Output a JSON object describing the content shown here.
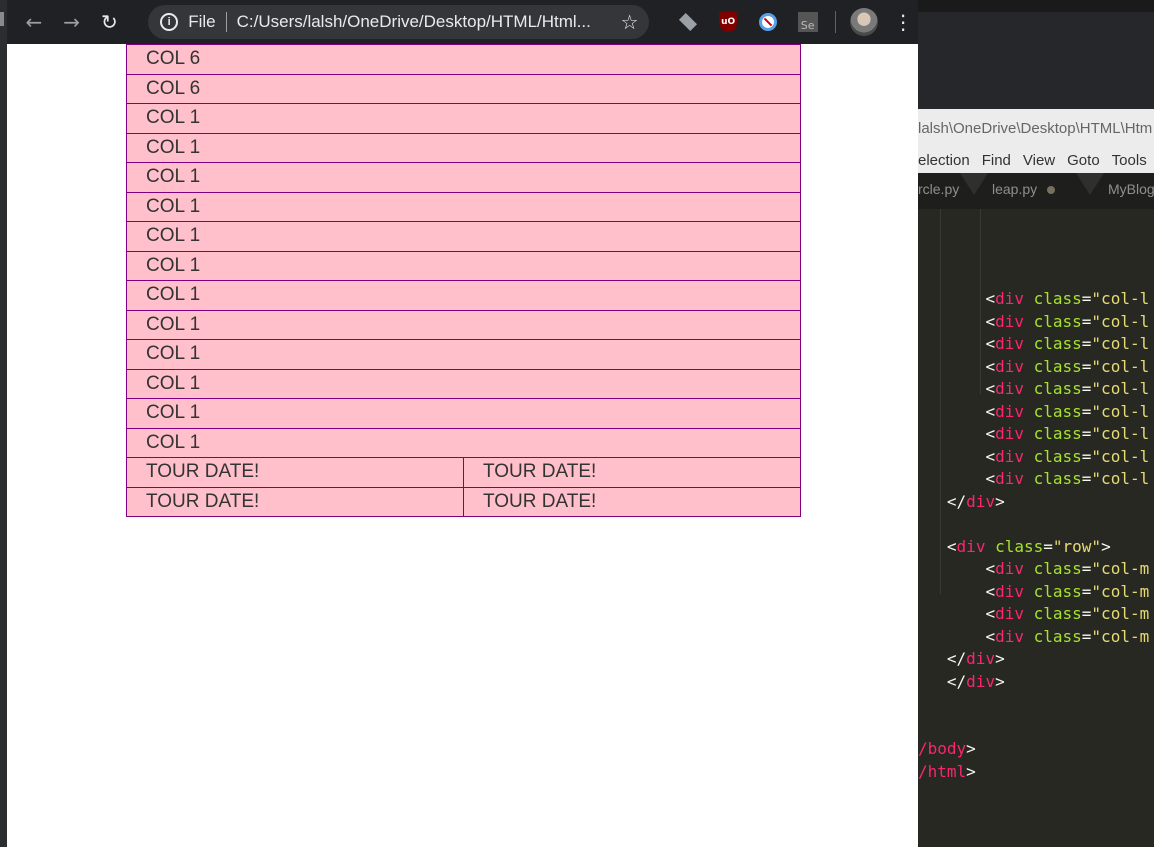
{
  "browser": {
    "omnibox": {
      "scheme": "File",
      "url": "C:/Users/lalsh/OneDrive/Desktop/HTML/Html..."
    },
    "extensions": [
      "layers-icon",
      "ublock-icon",
      "no-entry-icon",
      "selenium-icon"
    ]
  },
  "page": {
    "rows": [
      [
        "COL 6"
      ],
      [
        "COL 6"
      ],
      [
        "COL 1"
      ],
      [
        "COL 1"
      ],
      [
        "COL 1"
      ],
      [
        "COL 1"
      ],
      [
        "COL 1"
      ],
      [
        "COL 1"
      ],
      [
        "COL 1"
      ],
      [
        "COL 1"
      ],
      [
        "COL 1"
      ],
      [
        "COL 1"
      ],
      [
        "COL 1"
      ],
      [
        "COL 1"
      ],
      [
        "TOUR DATE!",
        "TOUR DATE!"
      ],
      [
        "TOUR DATE!",
        "TOUR DATE!"
      ]
    ],
    "colors": {
      "cell_bg": "#ffc0cb",
      "cell_border": "#800080"
    }
  },
  "editor": {
    "title": "lalsh\\OneDrive\\Desktop\\HTML\\Htm",
    "menu": [
      "election",
      "Find",
      "View",
      "Goto",
      "Tools"
    ],
    "tabs": [
      "rcle.py",
      "leap.py",
      "MyBlog"
    ],
    "code_lines": [
      {
        "indent": "       ",
        "open": "<",
        "tag": "div",
        "attr": " class",
        "eq": "=",
        "str": "\"col-l",
        "close": "",
        "partial_top": true
      },
      {
        "indent": "       ",
        "open": "<",
        "tag": "div",
        "attr": " class",
        "eq": "=",
        "str": "\"col-l",
        "close": ""
      },
      {
        "indent": "       ",
        "open": "<",
        "tag": "div",
        "attr": " class",
        "eq": "=",
        "str": "\"col-l",
        "close": ""
      },
      {
        "indent": "       ",
        "open": "<",
        "tag": "div",
        "attr": " class",
        "eq": "=",
        "str": "\"col-l",
        "close": ""
      },
      {
        "indent": "       ",
        "open": "<",
        "tag": "div",
        "attr": " class",
        "eq": "=",
        "str": "\"col-l",
        "close": ""
      },
      {
        "indent": "       ",
        "open": "<",
        "tag": "div",
        "attr": " class",
        "eq": "=",
        "str": "\"col-l",
        "close": ""
      },
      {
        "indent": "       ",
        "open": "<",
        "tag": "div",
        "attr": " class",
        "eq": "=",
        "str": "\"col-l",
        "close": ""
      },
      {
        "indent": "       ",
        "open": "<",
        "tag": "div",
        "attr": " class",
        "eq": "=",
        "str": "\"col-l",
        "close": ""
      },
      {
        "indent": "       ",
        "open": "<",
        "tag": "div",
        "attr": " class",
        "eq": "=",
        "str": "\"col-l",
        "close": ""
      },
      {
        "indent": "   ",
        "open": "</",
        "tag": "div",
        "attr": "",
        "eq": "",
        "str": "",
        "close": ">"
      },
      {
        "indent": "",
        "open": "",
        "tag": "",
        "attr": "",
        "eq": "",
        "str": "",
        "close": ""
      },
      {
        "indent": "   ",
        "open": "<",
        "tag": "div",
        "attr": " class",
        "eq": "=",
        "str": "\"row\"",
        "close": ">"
      },
      {
        "indent": "       ",
        "open": "<",
        "tag": "div",
        "attr": " class",
        "eq": "=",
        "str": "\"col-m",
        "close": ""
      },
      {
        "indent": "       ",
        "open": "<",
        "tag": "div",
        "attr": " class",
        "eq": "=",
        "str": "\"col-m",
        "close": ""
      },
      {
        "indent": "       ",
        "open": "<",
        "tag": "div",
        "attr": " class",
        "eq": "=",
        "str": "\"col-m",
        "close": ""
      },
      {
        "indent": "       ",
        "open": "<",
        "tag": "div",
        "attr": " class",
        "eq": "=",
        "str": "\"col-m",
        "close": ""
      },
      {
        "indent": "   ",
        "open": "</",
        "tag": "div",
        "attr": "",
        "eq": "",
        "str": "",
        "close": ">"
      },
      {
        "indent": "   ",
        "open": "</",
        "tag": "div",
        "attr": "",
        "eq": "",
        "str": "",
        "close": ">"
      },
      {
        "indent": "",
        "open": "",
        "tag": "",
        "attr": "",
        "eq": "",
        "str": "",
        "close": ""
      },
      {
        "indent": "",
        "open": "",
        "tag": "",
        "attr": "",
        "eq": "",
        "str": "",
        "close": ""
      },
      {
        "indent": "",
        "open": "/",
        "tag": "body",
        "attr": "",
        "eq": "",
        "str": "",
        "close": ">"
      },
      {
        "indent": "",
        "open": "/",
        "tag": "html",
        "attr": "",
        "eq": "",
        "str": "",
        "close": ">"
      }
    ]
  }
}
